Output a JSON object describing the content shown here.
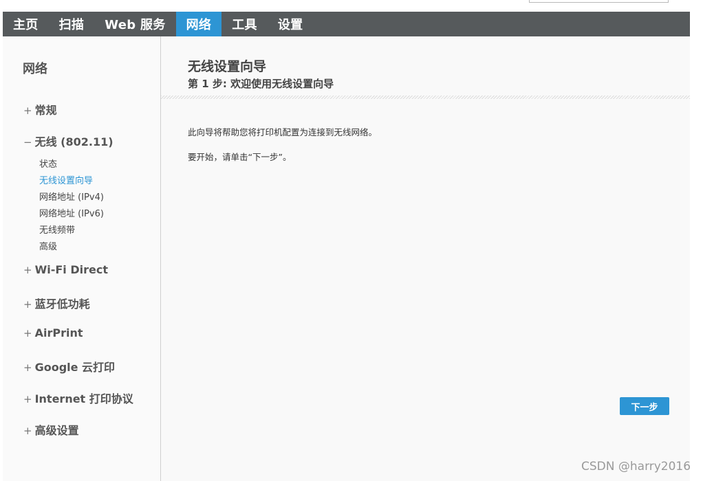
{
  "nav": {
    "items": [
      {
        "label": "主页"
      },
      {
        "label": "扫描"
      },
      {
        "label": "Web 服务"
      },
      {
        "label": "网络"
      },
      {
        "label": "工具"
      },
      {
        "label": "设置"
      }
    ],
    "active_index": 3,
    "bg_color": "#565a5c",
    "active_color": "#2d95d4"
  },
  "sidebar": {
    "title": "网络",
    "expanded_sign": "−",
    "collapsed_sign": "+",
    "sections": [
      {
        "label": "常规",
        "expanded": false
      },
      {
        "label": "无线 (802.11)",
        "expanded": true,
        "items": [
          "状态",
          "无线设置向导",
          "网络地址 (IPv4)",
          "网络地址 (IPv6)",
          "无线频带",
          "高级"
        ],
        "active_item": "无线设置向导"
      },
      {
        "label": "Wi-Fi Direct",
        "expanded": false
      },
      {
        "label": "蓝牙低功耗",
        "expanded": false
      },
      {
        "label": "AirPrint",
        "expanded": false
      },
      {
        "label": "Google 云打印",
        "expanded": false
      },
      {
        "label": "Internet 打印协议",
        "expanded": false
      },
      {
        "label": "高级设置",
        "expanded": false
      }
    ]
  },
  "main": {
    "title": "无线设置向导",
    "subtitle": "第 1 步: 欢迎使用无线设置向导",
    "paragraphs": [
      "此向导将帮助您将打印机配置为连接到无线网络。",
      "要开始，请单击“下一步”。"
    ],
    "next_button": "下一步"
  },
  "watermark": "CSDN @harry2016"
}
